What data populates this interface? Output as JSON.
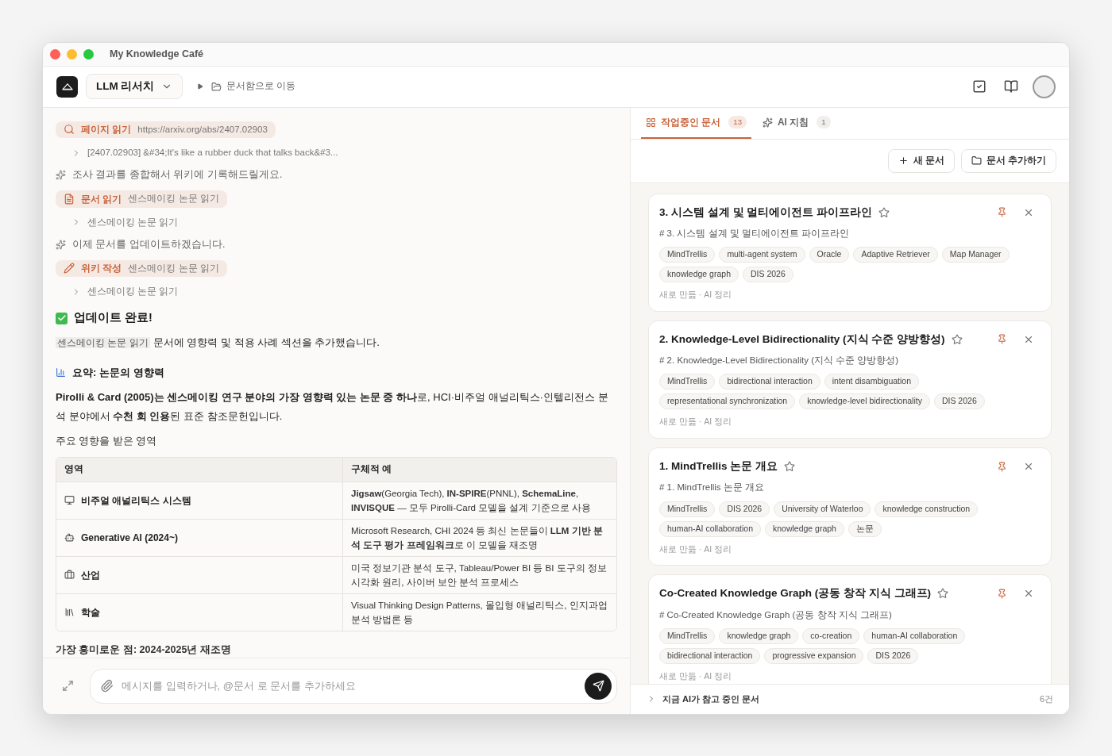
{
  "window": {
    "title": "My Knowledge Café"
  },
  "header": {
    "workspace": "LLM 리서치",
    "breadcrumb": "문서함으로 이동"
  },
  "chat": {
    "steps": [
      {
        "kind": "search",
        "label": "페이지 읽기",
        "arg": "https://arxiv.org/abs/2407.02903"
      },
      {
        "kind": "result",
        "text": "[2407.02903] &#34;It's like a rubber duck that talks back&#3..."
      },
      {
        "kind": "thought",
        "text": "조사 결과를 종합해서 위키에 기록해드릴게요."
      },
      {
        "kind": "read",
        "label": "문서 읽기",
        "arg": "센스메이킹 논문 읽기"
      },
      {
        "kind": "result",
        "text": "센스메이킹 논문 읽기"
      },
      {
        "kind": "thought",
        "text": "이제 문서를 업데이트하겠습니다."
      },
      {
        "kind": "write",
        "label": "위키 작성",
        "arg": "센스메이킹 논문 읽기"
      },
      {
        "kind": "result",
        "text": "센스메이킹 논문 읽기"
      }
    ],
    "done_heading": "업데이트 완료!",
    "done_doc": "센스메이킹 논문 읽기",
    "done_text": "문서에 영향력 및 적용 사례 섹션을 추가했습니다.",
    "summary_heading": "요약: 논문의 영향력",
    "summary": "**Pirolli & Card (2005)는 센스메이킹 연구 분야의 가장 영향력 있는 논문 중 하나**로, HCI·비주얼 애널리틱스·인텔리전스 분석 분야에서 **수천 회 인용**된 표준 참조문헌입니다.",
    "table_caption": "주요 영향을 받은 영역",
    "table": {
      "columns": [
        "영역",
        "구체적 예"
      ],
      "rows": [
        {
          "area": "비주얼 애널리틱스 시스템",
          "examples": "**Jigsaw**(Georgia Tech), **IN-SPIRE**(PNNL), **SchemaLine**, **INVISQUE** — 모두 Pirolli-Card 모델을 설계 기준으로 사용"
        },
        {
          "area": "Generative AI (2024~)",
          "examples": "Microsoft Research, CHI 2024 등 최신 논문들이 **LLM 기반 분석 도구 평가 프레임워크**로 이 모델을 재조명"
        },
        {
          "area": "산업",
          "examples": "미국 정보기관 분석 도구, Tableau/Power BI 등 BI 도구의 정보 시각화 원리, 사이버 보안 분석 프로세스"
        },
        {
          "area": "학술",
          "examples": "Visual Thinking Design Patterns, 몰입형 애널리틱스, 인지과업 분석 방법론 등"
        }
      ]
    },
    "trailing_heading": "가장 흥미로운 점: 2024-2025년 재조명",
    "input_placeholder": "메시지를 입력하거나, @문서 로 문서를 추가하세요"
  },
  "panel": {
    "tabs": [
      {
        "label": "작업중인 문서",
        "count": "13",
        "selected": true
      },
      {
        "label": "AI 지침",
        "count": "1",
        "selected": false
      }
    ],
    "buttons": [
      "새 문서",
      "문서 추가하기"
    ],
    "cards": [
      {
        "title": "3. 시스템 설계 및 멀티에이전트 파이프라인",
        "subtitle": "# 3. 시스템 설계 및 멀티에이전트 파이프라인",
        "starred": false,
        "pinned": true,
        "tags": [
          "MindTrellis",
          "multi-agent system",
          "Oracle",
          "Adaptive Retriever",
          "Map Manager",
          "knowledge graph",
          "DIS 2026"
        ],
        "meta": "새로 만듦 · AI 정리"
      },
      {
        "title": "2. Knowledge-Level Bidirectionality (지식 수준 양방향성)",
        "subtitle": "# 2. Knowledge-Level Bidirectionality (지식 수준 양방향성)",
        "starred": false,
        "pinned": true,
        "tags": [
          "MindTrellis",
          "bidirectional interaction",
          "intent disambiguation",
          "representational synchronization",
          "knowledge-level bidirectionality",
          "DIS 2026"
        ],
        "meta": "새로 만듦 · AI 정리"
      },
      {
        "title": "1. MindTrellis 논문 개요",
        "subtitle": "# 1. MindTrellis 논문 개요",
        "starred": false,
        "pinned": true,
        "tags": [
          "MindTrellis",
          "DIS 2026",
          "University of Waterloo",
          "knowledge construction",
          "human-AI collaboration",
          "knowledge graph",
          "논문"
        ],
        "meta": "새로 만듦 · AI 정리"
      },
      {
        "title": "Co-Created Knowledge Graph (공동 창작 지식 그래프)",
        "subtitle": "# Co-Created Knowledge Graph (공동 창작 지식 그래프)",
        "starred": false,
        "pinned": true,
        "tags": [
          "MindTrellis",
          "knowledge graph",
          "co-creation",
          "human-AI collaboration",
          "bidirectional interaction",
          "progressive expansion",
          "DIS 2026"
        ],
        "meta": "새로 만듦 · AI 정리"
      }
    ],
    "footer": {
      "label": "지금 AI가 참고 중인 문서",
      "count": "6건",
      "expanded": false
    }
  }
}
